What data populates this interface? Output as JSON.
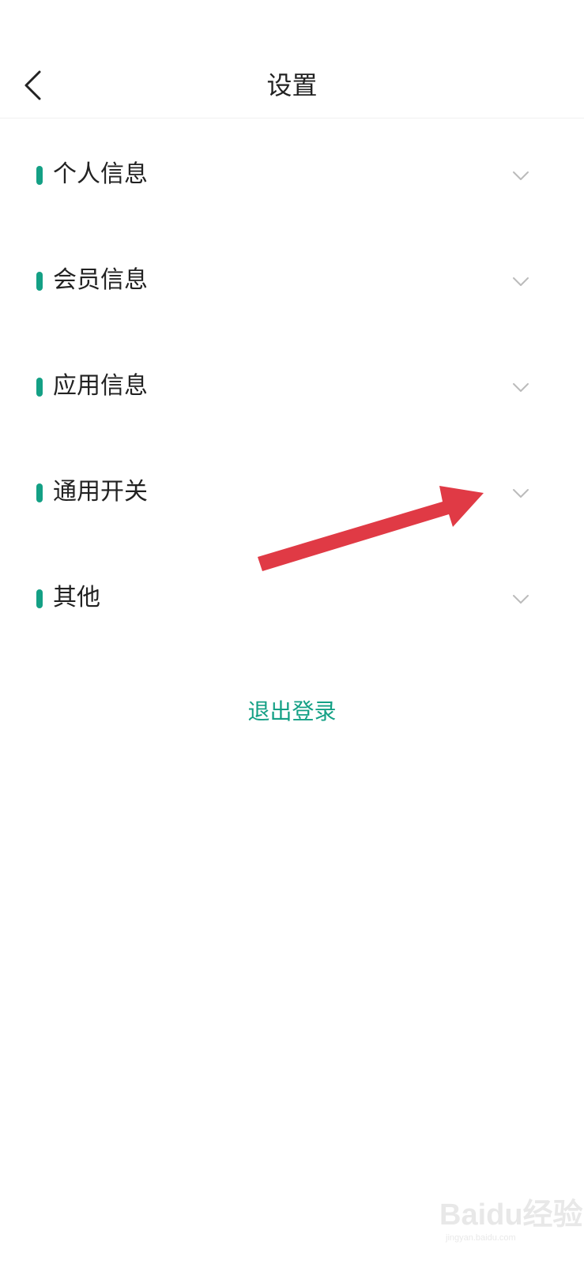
{
  "header": {
    "title": "设置"
  },
  "sections": [
    {
      "label": "个人信息"
    },
    {
      "label": "会员信息"
    },
    {
      "label": "应用信息"
    },
    {
      "label": "通用开关"
    },
    {
      "label": "其他"
    }
  ],
  "logout_label": "退出登录",
  "watermark": {
    "text": "Baidu经验",
    "url_text": "jingyan.baidu.com"
  },
  "colors": {
    "accent": "#14a085",
    "annotation_arrow": "#e03a45",
    "chevron": "#bbbbbb",
    "text": "#222222"
  },
  "icons": {
    "back": "chevron-left-icon",
    "expand": "chevron-down-icon",
    "annotation": "red-arrow-icon"
  }
}
